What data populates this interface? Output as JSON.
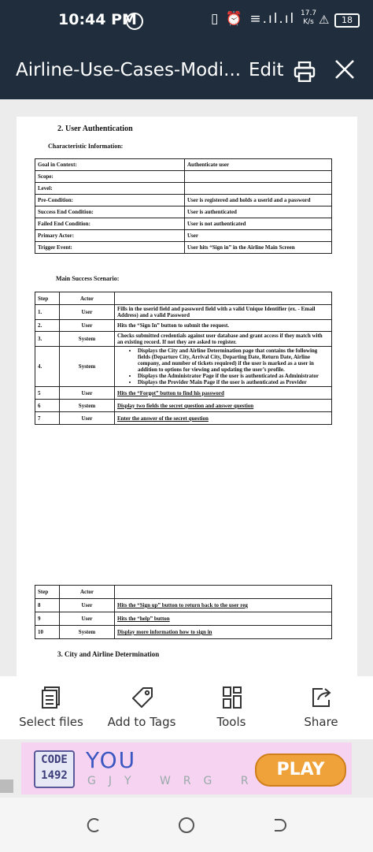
{
  "status_bar": {
    "time": "10:44 PM",
    "net_speed_value": "17.7",
    "net_speed_unit": "K/s",
    "battery": "18"
  },
  "app_bar": {
    "title": "Airline-Use-Cases-Modi...",
    "edit_label": "Edit"
  },
  "document": {
    "heading": "2. User Authentication",
    "subheading": "Characteristic Information:",
    "characteristics": [
      {
        "key": "Goal in Context:",
        "value": "Authenticate user"
      },
      {
        "key": "Scope:",
        "value": ""
      },
      {
        "key": "Level:",
        "value": ""
      },
      {
        "key": "Pre-Condition:",
        "value": "User is registered and holds a userid and a password"
      },
      {
        "key": "Success End Condition:",
        "value": "User is authenticated"
      },
      {
        "key": "Failed End Condition:",
        "value": "User is not authenticated"
      },
      {
        "key": "Primary Actor:",
        "value": "User"
      },
      {
        "key": "Trigger Event:",
        "value": "User hits “Sign in” in the Airline Main Screen"
      }
    ],
    "main_success_label": "Main Success Scenario:",
    "scenario_headers": {
      "step": "Step",
      "actor": "Actor"
    },
    "scenario": [
      {
        "step": "1.",
        "actor": "User",
        "action": "Fills in the userid field and password field with a valid Unique Identifier (ex. - Email Address) and a valid Password"
      },
      {
        "step": "2.",
        "actor": "User",
        "action": "Hits the “Sign In” button to submit the request."
      },
      {
        "step": "3.",
        "actor": "System",
        "action": "Checks submitted credentials against user database and grant access if they match with an existing record. If not they are asked to register."
      },
      {
        "step": "4.",
        "actor": "System",
        "bullets": [
          "Displays the City and Airline Determination page that contains the following fields (Departure City, Arrival City, Departing Date, Return Date, Airline company, and number of tickets required) if the user is marked as a user in addition to options for viewing and updating the user’s profile.",
          "Displays the Administrator Page if the user is authenticated as Administrator",
          "Displays the Provider Main Page if the user is authenticated as Provider"
        ]
      },
      {
        "step": "5",
        "actor": "User",
        "action": "Hits the “Forgot” button to find his password"
      },
      {
        "step": "6",
        "actor": "System",
        "action": "Display two fields the secret question and answer question"
      },
      {
        "step": "7",
        "actor": "User",
        "action": "Enter the answer of the secret question"
      }
    ],
    "scenario2": [
      {
        "step": "8",
        "actor": "User",
        "action": "Hits the “Sign up” button to return back to the user reg"
      },
      {
        "step": "9",
        "actor": "User",
        "action": "Hits the “help” button"
      },
      {
        "step": "10",
        "actor": "System",
        "action": "Display more information how to sign in"
      }
    ],
    "next_heading": "3. City and Airline Determination"
  },
  "fab": {
    "icon": "pencil-icon",
    "color": "#d9383a"
  },
  "bottom_bar": {
    "items": [
      {
        "label": "Select files",
        "icon": "select-files-icon"
      },
      {
        "label": "Add to Tags",
        "icon": "tag-icon"
      },
      {
        "label": "Tools",
        "icon": "tools-icon"
      },
      {
        "label": "Share",
        "icon": "share-icon"
      }
    ]
  },
  "ad": {
    "code_top": "CODE",
    "code_bottom": "1492",
    "word": "YOU",
    "letters": "GJY WRG RG",
    "play_label": "PLAY"
  },
  "colors": {
    "app_bar": "#1f2d3d",
    "accent": "#d9383a"
  }
}
